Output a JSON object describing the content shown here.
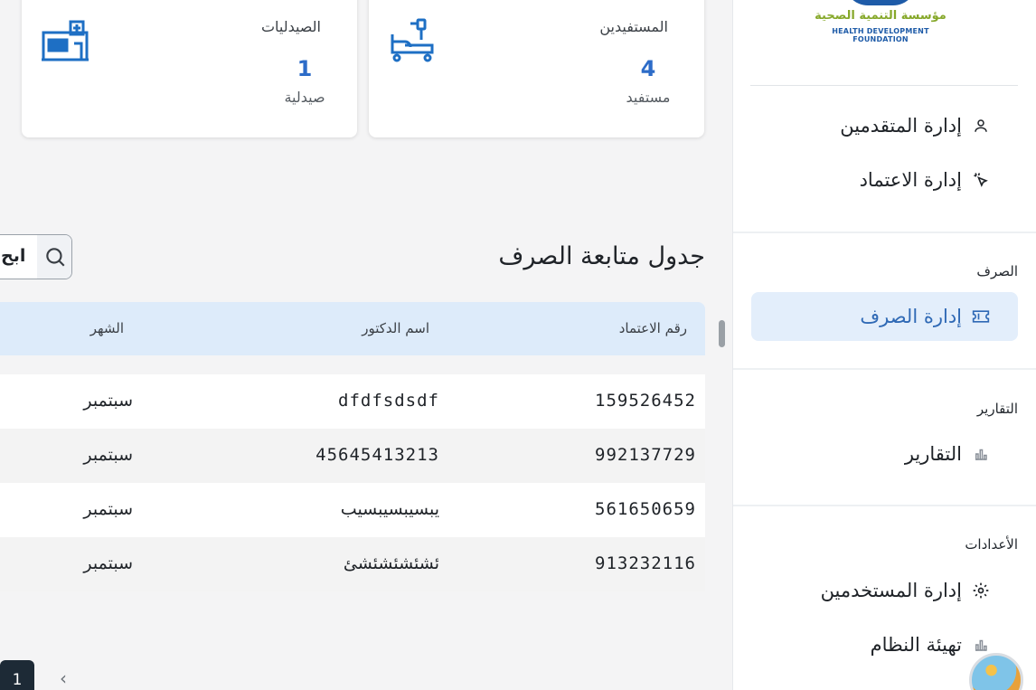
{
  "org": {
    "name_ar": "مؤسسة التنمية الصحية",
    "name_en": "HEALTH DEVELOPMENT FOUNDATION"
  },
  "sidebar": {
    "group1": [
      {
        "label": "إدارة المتقدمين",
        "icon": "user-icon"
      },
      {
        "label": "إدارة الاعتماد",
        "icon": "pointer-click-icon"
      }
    ],
    "sections": [
      {
        "title": "الصرف",
        "items": [
          {
            "label": "إدارة الصرف",
            "icon": "ticket-icon",
            "active": true
          }
        ]
      },
      {
        "title": "التقارير",
        "items": [
          {
            "label": "التقارير",
            "icon": "bar-chart-icon"
          }
        ]
      },
      {
        "title": "الأعدادات",
        "items": [
          {
            "label": "إدارة المستخدمين",
            "icon": "gear-icon"
          },
          {
            "label": "تهيئة النظام",
            "icon": "bar-chart-icon"
          }
        ]
      }
    ]
  },
  "stats": [
    {
      "title": "المستفيدين",
      "value": "4",
      "unit": "مستفيد",
      "icon": "hospital-bed-icon"
    },
    {
      "title": "الصيدليات",
      "value": "1",
      "unit": "صيدلية",
      "icon": "pharmacy-building-icon"
    }
  ],
  "table": {
    "title": "جدول متابعة الصرف",
    "search_placeholder": "ابح",
    "columns": [
      "رقم الاعتماد",
      "اسم الدكتور",
      "الشهر"
    ],
    "rows": [
      [
        "159526452",
        "dfdfsdsdf",
        "سبتمبر"
      ],
      [
        "992137729",
        "45645413213",
        "سبتمبر"
      ],
      [
        "561650659",
        "يبسيبسيبسيب",
        "سبتمبر"
      ],
      [
        "913232116",
        "ئشئشئشئشئ",
        "سبتمبر"
      ]
    ]
  },
  "pagination": {
    "current": "1",
    "next_symbol": "›"
  },
  "colors": {
    "accent": "#2d6cc8",
    "active_bg": "#e3eefb",
    "header_bg": "#ddebfa"
  }
}
